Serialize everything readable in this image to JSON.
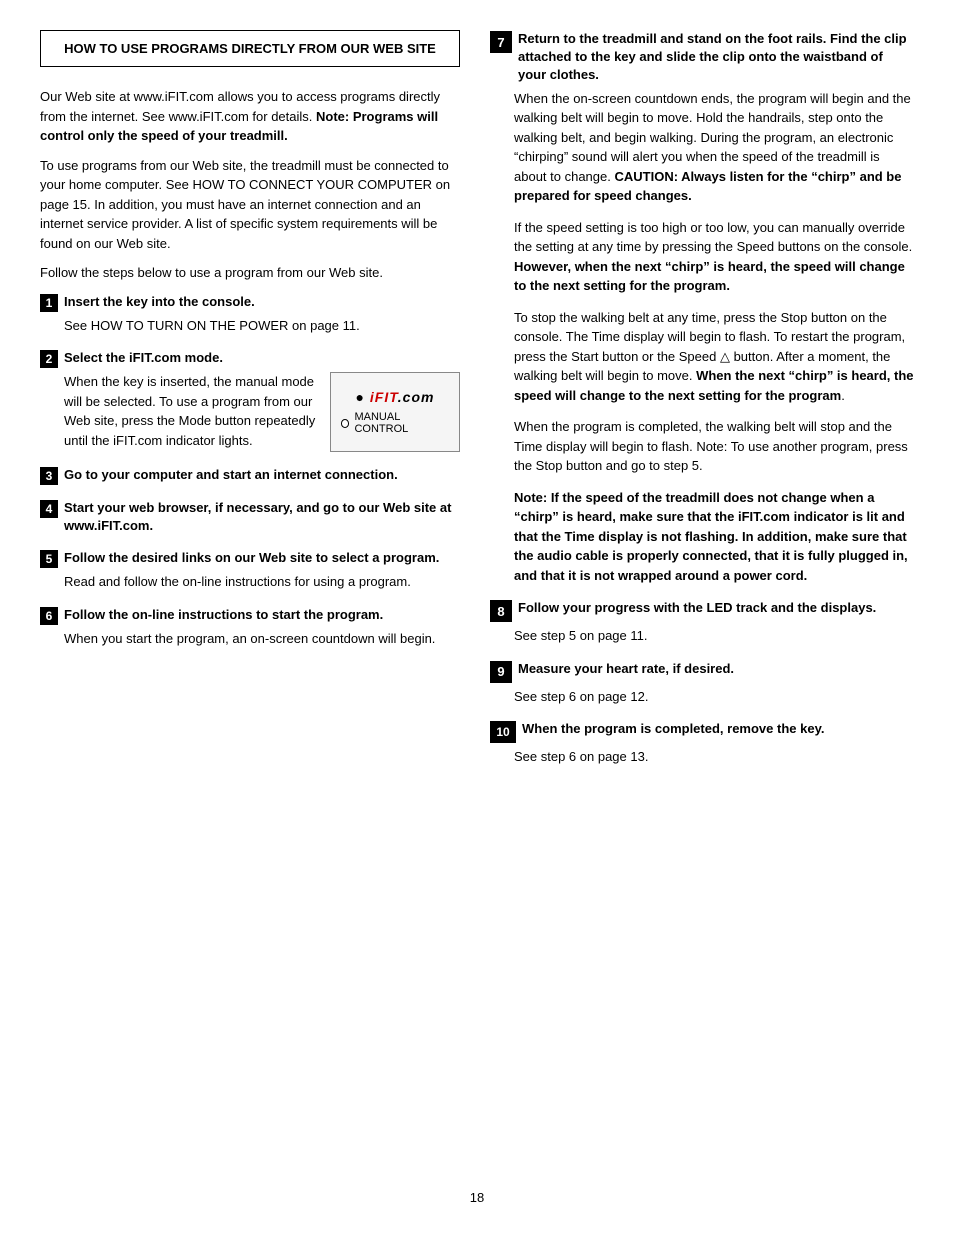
{
  "page": {
    "number": "18",
    "header": {
      "title": "HOW TO USE PROGRAMS DIRECTLY FROM OUR WEB SITE"
    },
    "left_column": {
      "intro_paragraphs": [
        "Our Web site at www.iFIT.com allows you to access programs directly from the internet. See www.iFIT.com for details. Note: Programs will control only the speed of your treadmill.",
        "To use programs from our Web site, the treadmill must be connected to your home computer. See HOW TO CONNECT YOUR COMPUTER on page 15. In addition, you must have an internet connection and an internet service provider. A list of specific system requirements will be found on our Web site.",
        "Follow the steps below to use a program from our Web site."
      ],
      "steps": [
        {
          "number": "1",
          "title": "Insert the key into the console.",
          "body": "See HOW TO TURN ON THE POWER on page 11.",
          "has_image": false
        },
        {
          "number": "2",
          "title": "Select the iFIT.com mode.",
          "body": "When the key is inserted, the manual mode will be selected. To use a program from our Web site, press the Mode button repeatedly until the iFIT.com indicator lights.",
          "has_image": true
        },
        {
          "number": "3",
          "title": "Go to your computer and start an internet connection.",
          "body": "",
          "has_image": false
        },
        {
          "number": "4",
          "title": "Start your web browser, if necessary, and go to our Web site at www.iFIT.com.",
          "body": "",
          "has_image": false
        },
        {
          "number": "5",
          "title": "Follow the desired links on our Web site to select a program.",
          "body": "Read and follow the on-line instructions for using a program.",
          "has_image": false
        },
        {
          "number": "6",
          "title": "Follow the on-line instructions to start the program.",
          "body": "When you start the program, an on-screen countdown will begin.",
          "has_image": false
        }
      ]
    },
    "right_column": {
      "steps": [
        {
          "number": "7",
          "title": "Return to the treadmill and stand on the foot rails. Find the clip attached to the key and slide the clip onto the waistband of your clothes.",
          "paragraphs": [
            "When the on-screen countdown ends, the program will begin and the walking belt will begin to move. Hold the handrails, step onto the walking belt, and begin walking. During the program, an electronic “chirping” sound will alert you when the speed of the treadmill is about to change. CAUTION: Always listen for the “chirp” and be prepared for speed changes.",
            "If the speed setting is too high or too low, you can manually override the setting at any time by pressing the Speed buttons on the console. However, when the next “chirp” is heard, the speed will change to the next setting for the program.",
            "To stop the walking belt at any time, press the Stop button on the console. The Time display will begin to flash. To restart the program, press the Start button or the Speed △ button. After a moment, the walking belt will begin to move. When the next “chirp” is heard, the speed will change to the next setting for the program.",
            "When the program is completed, the walking belt will stop and the Time display will begin to flash. Note: To use another program, press the Stop button and go to step 5.",
            "Note: If the speed of the treadmill does not change when a “chirp” is heard, make sure that the iFIT.com indicator is lit and that the Time display is not flashing. In addition, make sure that the audio cable is properly connected, that it is fully plugged in, and that it is not wrapped around a power cord."
          ]
        },
        {
          "number": "8",
          "title": "Follow your progress with the LED track and the displays.",
          "paragraphs": [
            "See step 5 on page 11."
          ]
        },
        {
          "number": "9",
          "title": "Measure your heart rate, if desired.",
          "paragraphs": [
            "See step 6 on page 12."
          ]
        },
        {
          "number": "10",
          "title": "When the program is completed, remove the key.",
          "paragraphs": [
            "See step 6 on page 13."
          ]
        }
      ]
    }
  }
}
